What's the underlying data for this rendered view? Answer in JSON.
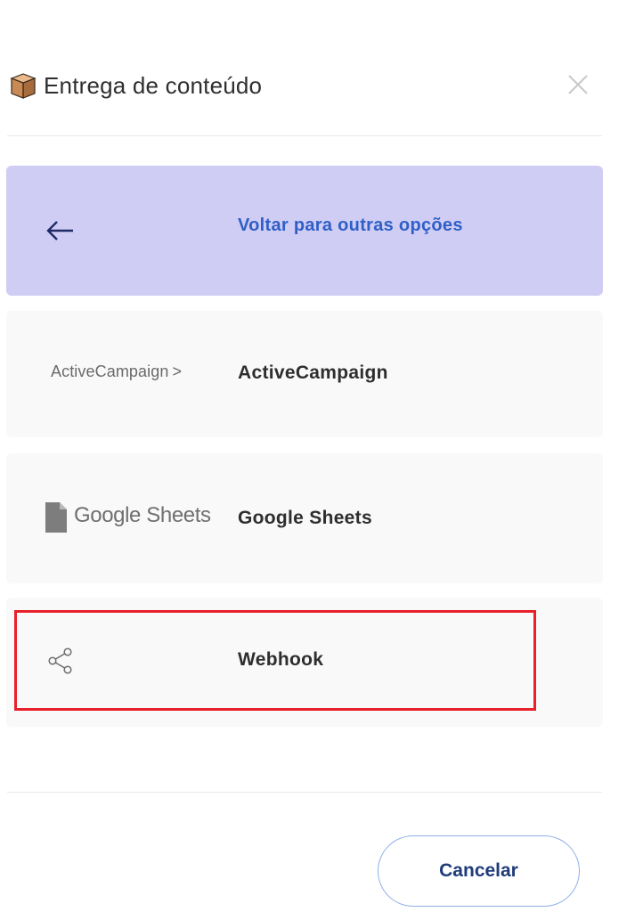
{
  "header": {
    "icon": "package-box-icon",
    "title": "Entrega de conteúdo",
    "close_icon": "close-icon"
  },
  "options": {
    "back": {
      "icon": "arrow-left-icon",
      "label": "Voltar para outras opções",
      "accent": "#cfcdf4",
      "text_color": "#2f5fc7"
    },
    "activecampaign": {
      "logo_text": "ActiveCampaign",
      "logo_mark": ">",
      "label": "ActiveCampaign"
    },
    "google_sheets": {
      "logo_icon": "document-icon",
      "logo_text": "Google Sheets",
      "label": "Google Sheets"
    },
    "webhook": {
      "icon": "share-icon",
      "label": "Webhook",
      "highlight_color": "#e8202a"
    }
  },
  "footer": {
    "cancel_label": "Cancelar"
  }
}
